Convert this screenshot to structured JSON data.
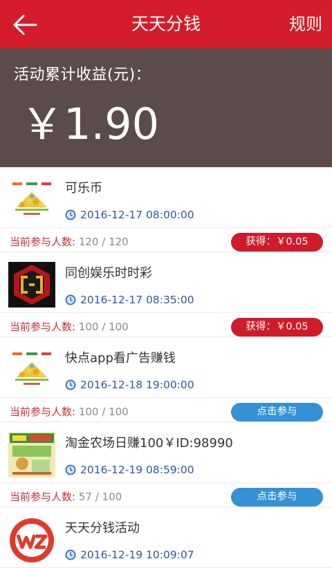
{
  "header": {
    "title": "天天分钱",
    "rules_label": "规则"
  },
  "summary": {
    "label": "活动累计收益(元)：",
    "amount": "￥1.90"
  },
  "count_label": "当前参与人数",
  "items": [
    {
      "name": "可乐币",
      "time": "2016-12-17 08:00:00",
      "count": "120 / 120",
      "action": "获得：￥0.05",
      "action_type": "earned",
      "icon": "pyramid-coins-icon"
    },
    {
      "name": "同创娱乐时时彩",
      "time": "2016-12-17 08:35:00",
      "count": "100 / 100",
      "action": "获得：￥0.05",
      "action_type": "earned",
      "icon": "red-logo-icon"
    },
    {
      "name": "快点app看广告赚钱",
      "time": "2016-12-18 19:00:00",
      "count": "100 / 100",
      "action": "点击参与",
      "action_type": "join",
      "icon": "pyramid-coins-icon"
    },
    {
      "name": "淘金农场日赚100￥ID:98990",
      "time": "2016-12-19 08:59:00",
      "count": "57 / 100",
      "action": "点击参与",
      "action_type": "join",
      "icon": "farm-poster-icon"
    },
    {
      "name": "天天分钱活动",
      "time": "2016-12-19 10:09:07",
      "count": "",
      "action": "",
      "action_type": "",
      "icon": "wz-logo-icon"
    }
  ],
  "colors": {
    "header_red": "#d51c2a",
    "summary_bg": "#5b4b4b",
    "earned_red": "#cf1b2a",
    "join_blue": "#3591d6",
    "time_blue": "#2e56a8"
  }
}
